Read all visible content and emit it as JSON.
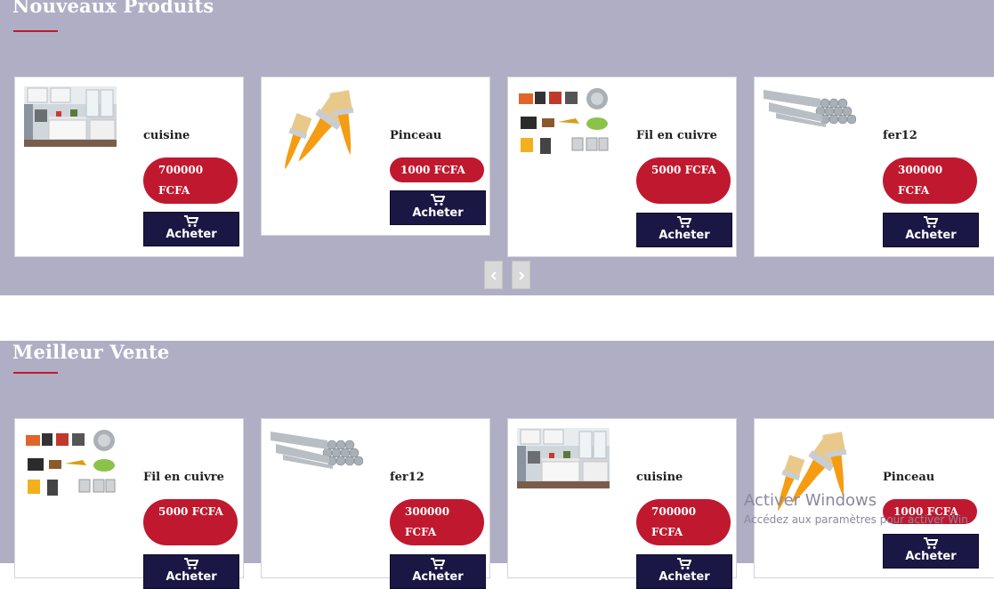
{
  "sections": [
    {
      "title": "Nouveaux Produits",
      "products": [
        {
          "name": "cuisine",
          "price": "700000 FCFA",
          "image": "kitchen-image",
          "buy_label": "Acheter"
        },
        {
          "name": "Pinceau",
          "price": "1000 FCFA",
          "image": "paintbrush-image",
          "buy_label": "Acheter"
        },
        {
          "name": "Fil en cuivre",
          "price": "5000 FCFA",
          "image": "electrical-tools-image",
          "buy_label": "Acheter"
        },
        {
          "name": "fer12",
          "price": "300000 FCFA",
          "image": "steel-rebar-image",
          "buy_label": "Acheter"
        }
      ],
      "carousel": {
        "prev_icon": "chevron-left-icon",
        "next_icon": "chevron-right-icon"
      }
    },
    {
      "title": "Meilleur Vente",
      "products": [
        {
          "name": "Fil en cuivre",
          "price": "5000 FCFA",
          "image": "electrical-tools-image",
          "buy_label": "Acheter"
        },
        {
          "name": "fer12",
          "price": "300000 FCFA",
          "image": "steel-rebar-image",
          "buy_label": "Acheter"
        },
        {
          "name": "cuisine",
          "price": "700000 FCFA",
          "image": "kitchen-image",
          "buy_label": "Acheter"
        },
        {
          "name": "Pinceau",
          "price": "1000 FCFA",
          "image": "paintbrush-image",
          "buy_label": "Acheter"
        }
      ]
    }
  ],
  "watermark": {
    "line1": "Activer Windows",
    "line2": "Accédez aux paramètres pour activer Win"
  },
  "colors": {
    "section_bg": "#b0aec4",
    "price_badge": "#c0192f",
    "buy_button": "#1b1744",
    "title_underline": "#c0192f"
  }
}
